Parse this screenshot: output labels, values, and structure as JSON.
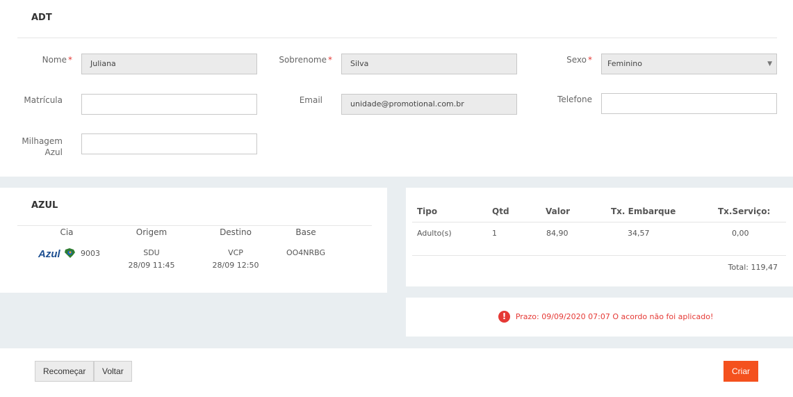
{
  "passenger": {
    "title": "ADT",
    "fields": {
      "nome": {
        "label": "Nome",
        "value": "Juliana"
      },
      "sobrenome": {
        "label": "Sobrenome",
        "value": "Silva"
      },
      "sexo": {
        "label": "Sexo",
        "value": "Feminino"
      },
      "matricula": {
        "label": "Matrícula",
        "value": ""
      },
      "email": {
        "label": "Email",
        "value": "unidade@promotional.com.br"
      },
      "telefone": {
        "label": "Telefone",
        "value": ""
      },
      "milhagem_line1": "Milhagem",
      "milhagem_line2": "Azul",
      "milhagem_value": ""
    },
    "required_mark": "*"
  },
  "flight": {
    "title": "AZUL",
    "headers": {
      "cia": "Cia",
      "origem": "Origem",
      "destino": "Destino",
      "base": "Base"
    },
    "row": {
      "airline_logo_text": "Azul",
      "flight_number": "9003",
      "origin": "SDU",
      "origin_time": "28/09 11:45",
      "destination": "VCP",
      "destination_time": "28/09 12:50",
      "base": "OO4NRBG"
    }
  },
  "fare": {
    "headers": {
      "tipo": "Tipo",
      "qtd": "Qtd",
      "valor": "Valor",
      "tx_embarque": "Tx. Embarque",
      "tx_servico": "Tx.Serviço:"
    },
    "row": {
      "tipo": "Adulto(s)",
      "qtd": "1",
      "valor": "84,90",
      "tx_embarque": "34,57",
      "tx_servico": "0,00"
    },
    "total": "Total: 119,47"
  },
  "alert": {
    "message": "Prazo: 09/09/2020 07:07 O acordo não foi aplicado!",
    "color": "#e53935"
  },
  "actions": {
    "restart": "Recomeçar",
    "back": "Voltar",
    "create": "Criar"
  },
  "colors": {
    "accent": "#f4511e",
    "azul_brand": "#1d4f91"
  }
}
